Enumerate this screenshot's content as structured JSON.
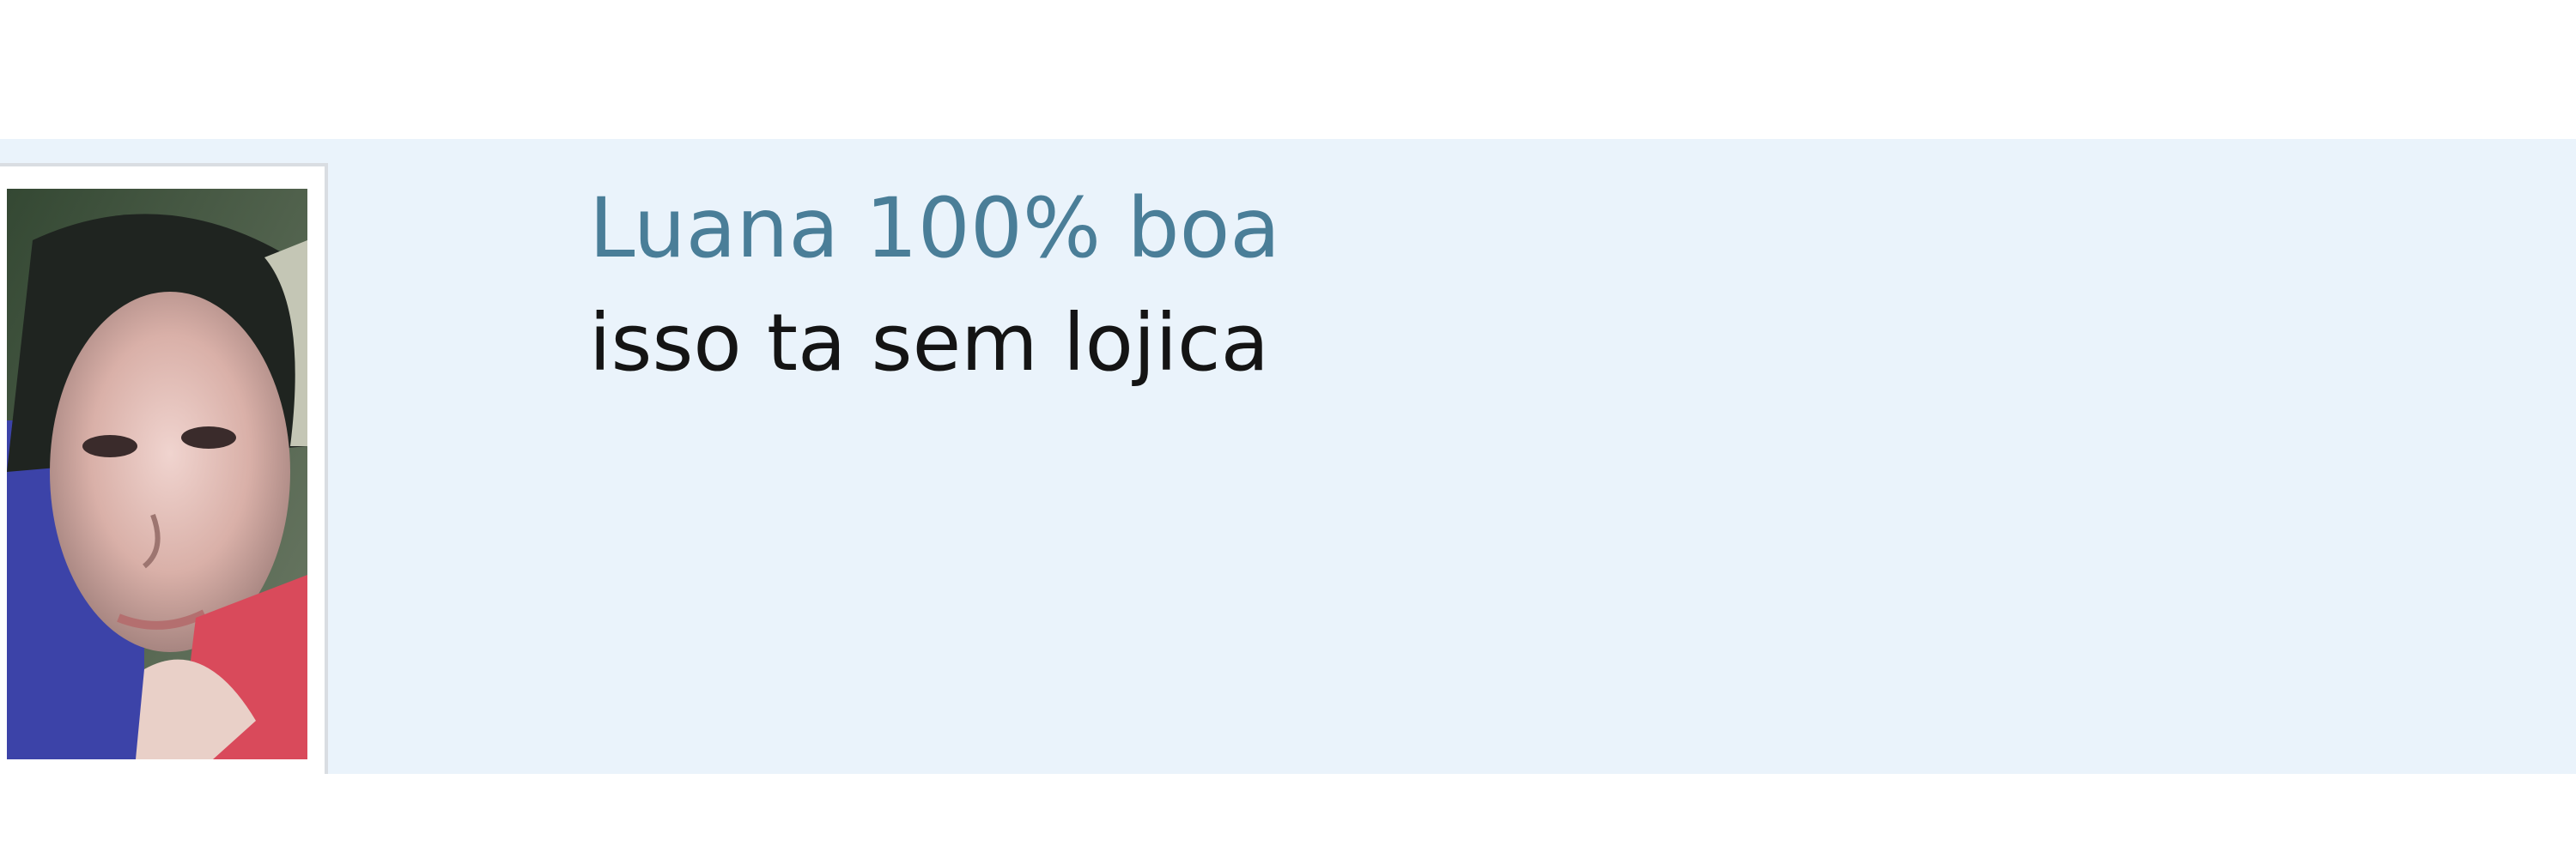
{
  "comment": {
    "author_name": "Luana 100% boa",
    "message": "isso ta sem lojica",
    "avatar_icon": "user-photo",
    "colors": {
      "row_background": "#eaf3fb",
      "author_link": "#4a7e98",
      "message_text": "#141414"
    }
  }
}
